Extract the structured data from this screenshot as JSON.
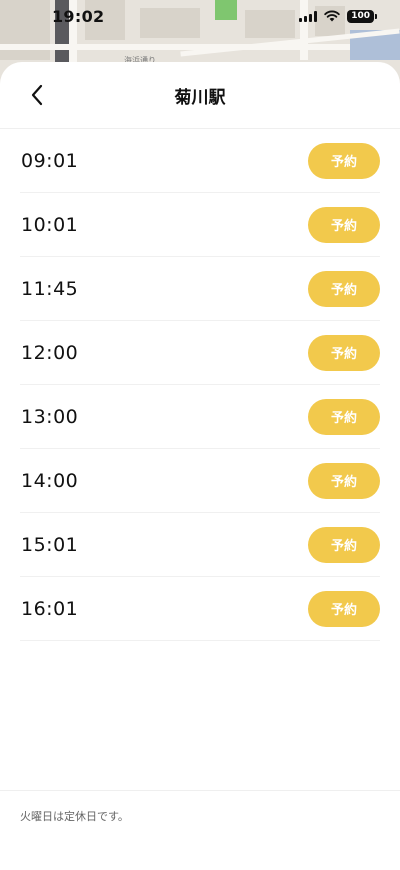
{
  "status_bar": {
    "time": "19:02",
    "battery": "100",
    "icons": [
      "signal-icon",
      "wifi-icon",
      "battery-icon"
    ]
  },
  "map": {
    "label": "海浜通り"
  },
  "header": {
    "title": "菊川駅",
    "back_icon": "chevron-left-icon"
  },
  "schedule": {
    "rows": [
      {
        "time": "09:01",
        "button": "予約"
      },
      {
        "time": "10:01",
        "button": "予約"
      },
      {
        "time": "11:45",
        "button": "予約"
      },
      {
        "time": "12:00",
        "button": "予約"
      },
      {
        "time": "13:00",
        "button": "予約"
      },
      {
        "time": "14:00",
        "button": "予約"
      },
      {
        "time": "15:01",
        "button": "予約"
      },
      {
        "time": "16:01",
        "button": "予約"
      }
    ]
  },
  "footer": {
    "note": "火曜日は定休日です。"
  },
  "colors": {
    "accent": "#f2c94c",
    "text": "#111111",
    "sheet": "#ffffff"
  }
}
